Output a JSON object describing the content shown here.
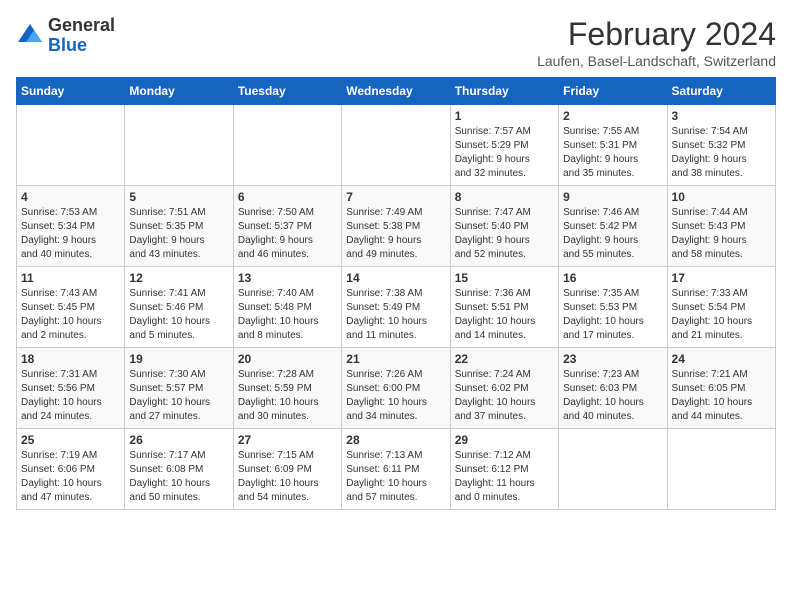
{
  "header": {
    "logo": {
      "line1": "General",
      "line2": "Blue"
    },
    "title": "February 2024",
    "subtitle": "Laufen, Basel-Landschaft, Switzerland"
  },
  "calendar": {
    "weekdays": [
      "Sunday",
      "Monday",
      "Tuesday",
      "Wednesday",
      "Thursday",
      "Friday",
      "Saturday"
    ],
    "weeks": [
      [
        {
          "day": "",
          "info": ""
        },
        {
          "day": "",
          "info": ""
        },
        {
          "day": "",
          "info": ""
        },
        {
          "day": "",
          "info": ""
        },
        {
          "day": "1",
          "info": "Sunrise: 7:57 AM\nSunset: 5:29 PM\nDaylight: 9 hours\nand 32 minutes."
        },
        {
          "day": "2",
          "info": "Sunrise: 7:55 AM\nSunset: 5:31 PM\nDaylight: 9 hours\nand 35 minutes."
        },
        {
          "day": "3",
          "info": "Sunrise: 7:54 AM\nSunset: 5:32 PM\nDaylight: 9 hours\nand 38 minutes."
        }
      ],
      [
        {
          "day": "4",
          "info": "Sunrise: 7:53 AM\nSunset: 5:34 PM\nDaylight: 9 hours\nand 40 minutes."
        },
        {
          "day": "5",
          "info": "Sunrise: 7:51 AM\nSunset: 5:35 PM\nDaylight: 9 hours\nand 43 minutes."
        },
        {
          "day": "6",
          "info": "Sunrise: 7:50 AM\nSunset: 5:37 PM\nDaylight: 9 hours\nand 46 minutes."
        },
        {
          "day": "7",
          "info": "Sunrise: 7:49 AM\nSunset: 5:38 PM\nDaylight: 9 hours\nand 49 minutes."
        },
        {
          "day": "8",
          "info": "Sunrise: 7:47 AM\nSunset: 5:40 PM\nDaylight: 9 hours\nand 52 minutes."
        },
        {
          "day": "9",
          "info": "Sunrise: 7:46 AM\nSunset: 5:42 PM\nDaylight: 9 hours\nand 55 minutes."
        },
        {
          "day": "10",
          "info": "Sunrise: 7:44 AM\nSunset: 5:43 PM\nDaylight: 9 hours\nand 58 minutes."
        }
      ],
      [
        {
          "day": "11",
          "info": "Sunrise: 7:43 AM\nSunset: 5:45 PM\nDaylight: 10 hours\nand 2 minutes."
        },
        {
          "day": "12",
          "info": "Sunrise: 7:41 AM\nSunset: 5:46 PM\nDaylight: 10 hours\nand 5 minutes."
        },
        {
          "day": "13",
          "info": "Sunrise: 7:40 AM\nSunset: 5:48 PM\nDaylight: 10 hours\nand 8 minutes."
        },
        {
          "day": "14",
          "info": "Sunrise: 7:38 AM\nSunset: 5:49 PM\nDaylight: 10 hours\nand 11 minutes."
        },
        {
          "day": "15",
          "info": "Sunrise: 7:36 AM\nSunset: 5:51 PM\nDaylight: 10 hours\nand 14 minutes."
        },
        {
          "day": "16",
          "info": "Sunrise: 7:35 AM\nSunset: 5:53 PM\nDaylight: 10 hours\nand 17 minutes."
        },
        {
          "day": "17",
          "info": "Sunrise: 7:33 AM\nSunset: 5:54 PM\nDaylight: 10 hours\nand 21 minutes."
        }
      ],
      [
        {
          "day": "18",
          "info": "Sunrise: 7:31 AM\nSunset: 5:56 PM\nDaylight: 10 hours\nand 24 minutes."
        },
        {
          "day": "19",
          "info": "Sunrise: 7:30 AM\nSunset: 5:57 PM\nDaylight: 10 hours\nand 27 minutes."
        },
        {
          "day": "20",
          "info": "Sunrise: 7:28 AM\nSunset: 5:59 PM\nDaylight: 10 hours\nand 30 minutes."
        },
        {
          "day": "21",
          "info": "Sunrise: 7:26 AM\nSunset: 6:00 PM\nDaylight: 10 hours\nand 34 minutes."
        },
        {
          "day": "22",
          "info": "Sunrise: 7:24 AM\nSunset: 6:02 PM\nDaylight: 10 hours\nand 37 minutes."
        },
        {
          "day": "23",
          "info": "Sunrise: 7:23 AM\nSunset: 6:03 PM\nDaylight: 10 hours\nand 40 minutes."
        },
        {
          "day": "24",
          "info": "Sunrise: 7:21 AM\nSunset: 6:05 PM\nDaylight: 10 hours\nand 44 minutes."
        }
      ],
      [
        {
          "day": "25",
          "info": "Sunrise: 7:19 AM\nSunset: 6:06 PM\nDaylight: 10 hours\nand 47 minutes."
        },
        {
          "day": "26",
          "info": "Sunrise: 7:17 AM\nSunset: 6:08 PM\nDaylight: 10 hours\nand 50 minutes."
        },
        {
          "day": "27",
          "info": "Sunrise: 7:15 AM\nSunset: 6:09 PM\nDaylight: 10 hours\nand 54 minutes."
        },
        {
          "day": "28",
          "info": "Sunrise: 7:13 AM\nSunset: 6:11 PM\nDaylight: 10 hours\nand 57 minutes."
        },
        {
          "day": "29",
          "info": "Sunrise: 7:12 AM\nSunset: 6:12 PM\nDaylight: 11 hours\nand 0 minutes."
        },
        {
          "day": "",
          "info": ""
        },
        {
          "day": "",
          "info": ""
        }
      ]
    ]
  }
}
